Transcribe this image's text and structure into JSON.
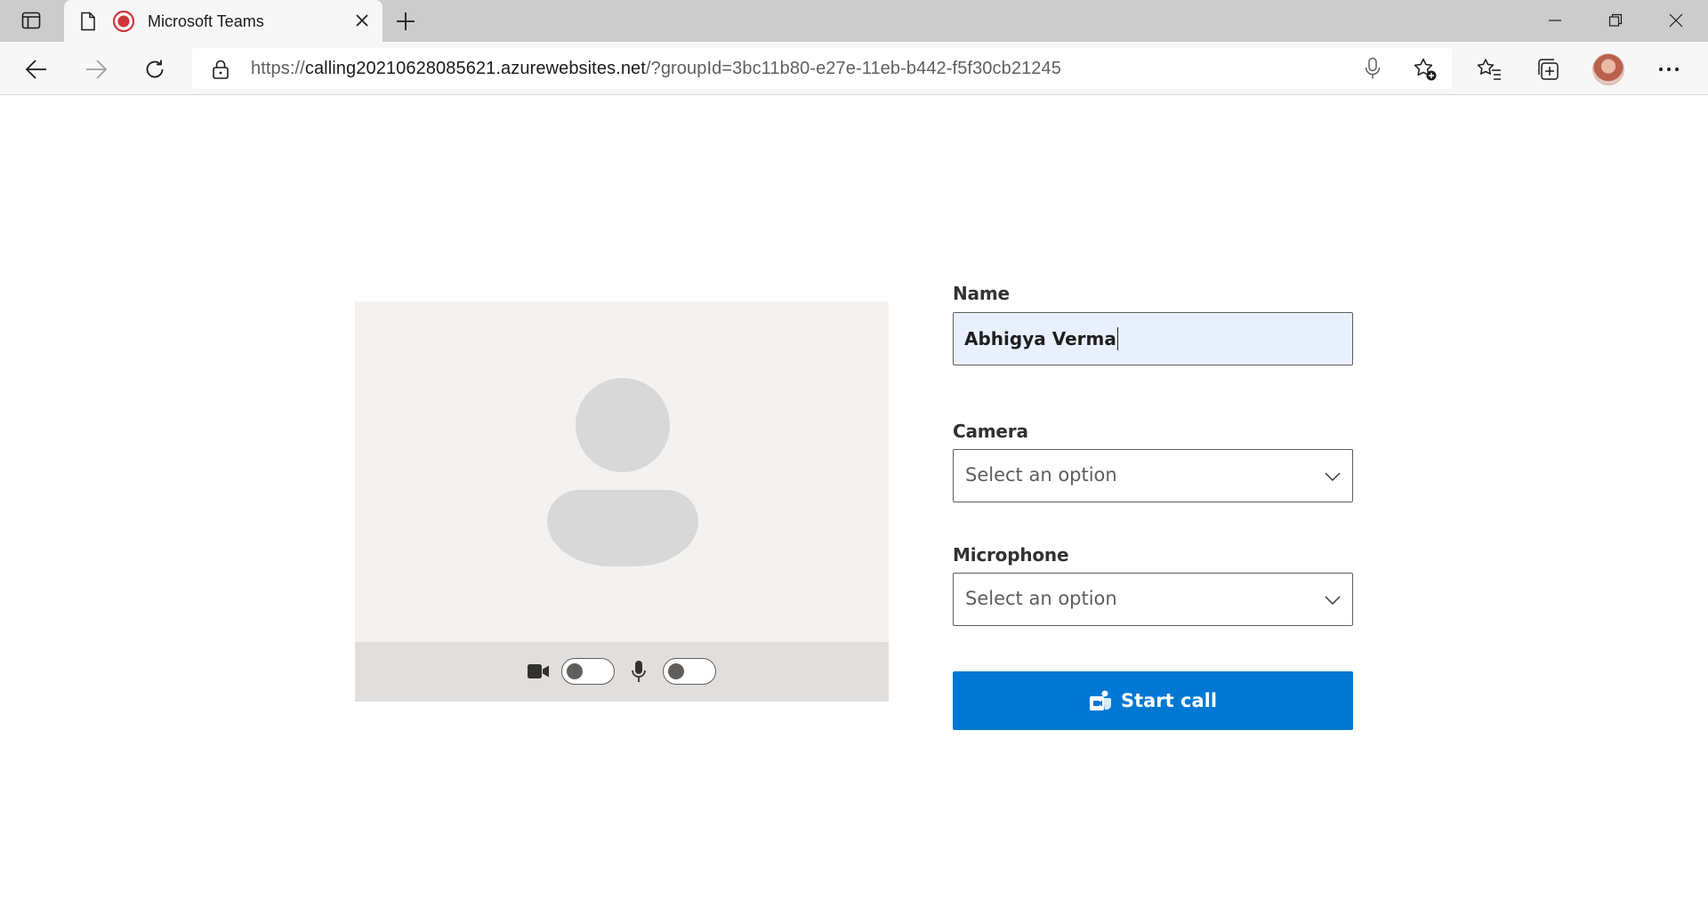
{
  "browser": {
    "tab": {
      "title": "Microsoft Teams"
    },
    "address": {
      "scheme": "https://",
      "host": "calling20210628085621.azurewebsites.net",
      "rest": "/?groupId=3bc11b80-e27e-11eb-b442-f5f30cb21245"
    }
  },
  "form": {
    "name_label": "Name",
    "name_value": "Abhigya Verma",
    "camera_label": "Camera",
    "camera_value": "Select an option",
    "microphone_label": "Microphone",
    "microphone_value": "Select an option",
    "start_label": "Start call"
  },
  "preview": {
    "camera_enabled": false,
    "microphone_enabled": false
  },
  "colors": {
    "accent": "#0078d4",
    "preview_bg": "#f3f2f1",
    "controls_bg": "#e1dfdd",
    "input_fill": "#e8f0fe"
  }
}
